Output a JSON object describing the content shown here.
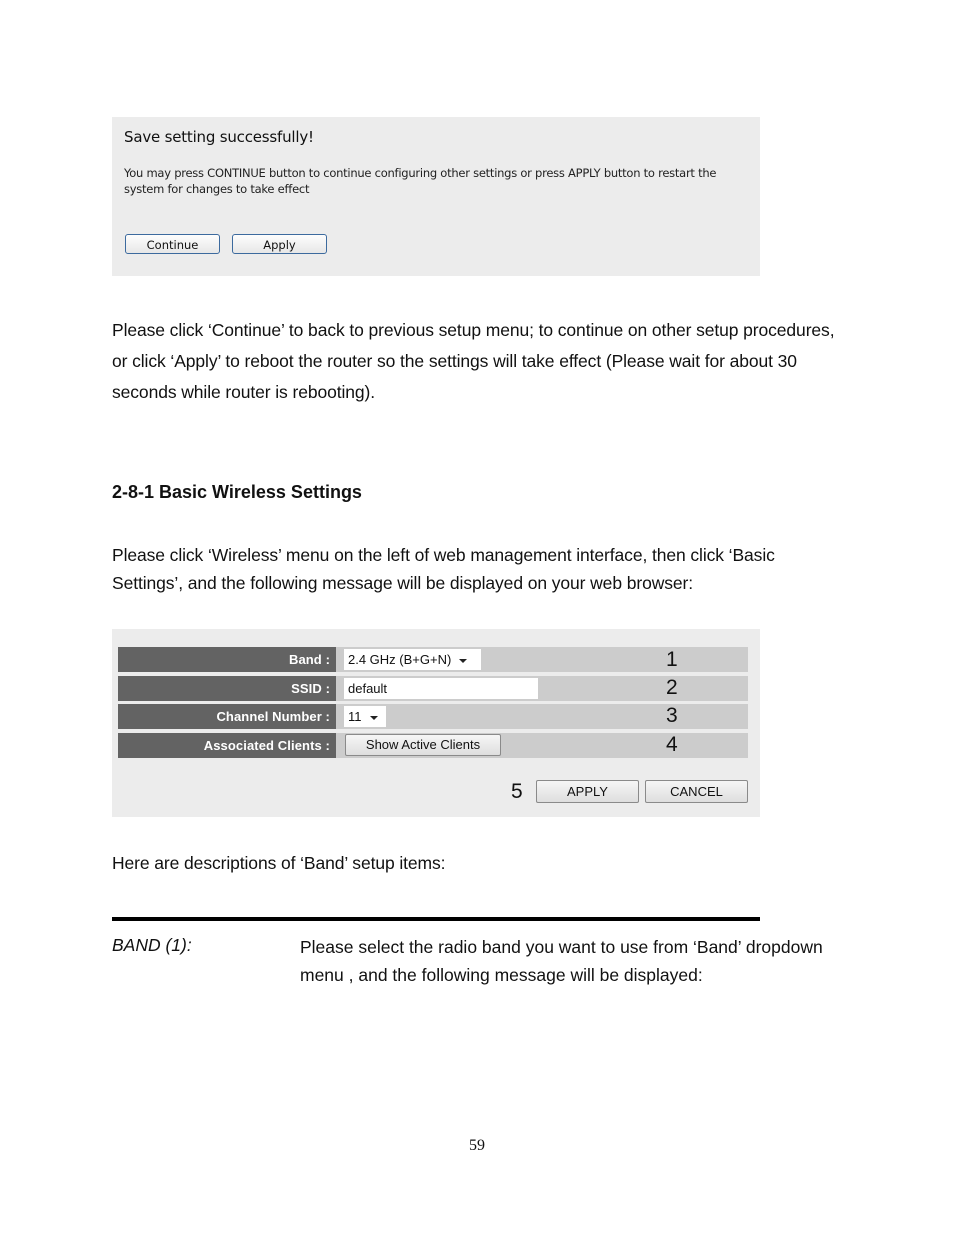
{
  "save_dialog": {
    "title": "Save setting successfully!",
    "message": "You may press CONTINUE button to continue configuring other settings or press APPLY button to restart the system for changes to take effect",
    "continue_label": "Continue",
    "apply_label": "Apply"
  },
  "paragraph_1": "Please click ‘Continue’ to back to previous setup menu; to continue on other setup procedures, or click ‘Apply’ to reboot the router so the settings will take effect (Please wait for about 30 seconds while router is rebooting).",
  "section_heading": "2-8-1 Basic Wireless Settings",
  "paragraph_2": "Please click ‘Wireless’ menu on the left of web management interface, then click ‘Basic Settings’, and the following message will be displayed on your web browser:",
  "wireless_form": {
    "rows": [
      {
        "label": "Band :",
        "value": "2.4 GHz (B+G+N)",
        "type": "select",
        "callout": "1"
      },
      {
        "label": "SSID :",
        "value": "default",
        "type": "text",
        "callout": "2"
      },
      {
        "label": "Channel Number :",
        "value": "11",
        "type": "select",
        "callout": "3"
      },
      {
        "label": "Associated Clients :",
        "value": "Show Active Clients",
        "type": "button",
        "callout": "4"
      }
    ],
    "apply_callout": "5",
    "apply_label": "APPLY",
    "cancel_label": "CANCEL"
  },
  "paragraph_3": "Here are descriptions of ‘Band’ setup items:",
  "band_item": {
    "term": "BAND (1):",
    "description": "Please select the radio band you want to use from ‘Band’ dropdown menu , and the following message will be displayed:"
  },
  "page_number": "59"
}
